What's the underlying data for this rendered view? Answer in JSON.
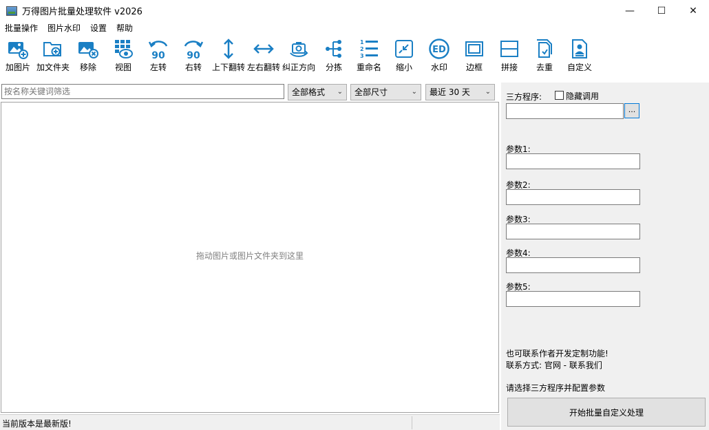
{
  "window": {
    "title": "万得图片批量处理软件 v2026",
    "minimize": "—",
    "maximize": "☐",
    "close": "✕"
  },
  "menu": [
    "批量操作",
    "图片水印",
    "设置",
    "帮助"
  ],
  "toolbar": [
    {
      "label": "加图片",
      "icon": "add-image-icon"
    },
    {
      "label": "加文件夹",
      "icon": "add-folder-icon"
    },
    {
      "label": "移除",
      "icon": "remove-image-icon"
    },
    {
      "label": "视图",
      "icon": "view-grid-icon"
    },
    {
      "label": "左转",
      "icon": "rotate-left-icon"
    },
    {
      "label": "右转",
      "icon": "rotate-right-icon"
    },
    {
      "label": "上下翻转",
      "icon": "flip-vertical-icon"
    },
    {
      "label": "左右翻转",
      "icon": "flip-horizontal-icon"
    },
    {
      "label": "纠正方向",
      "icon": "correct-orientation-icon"
    },
    {
      "label": "分拣",
      "icon": "sort-tree-icon"
    },
    {
      "label": "重命名",
      "icon": "rename-list-icon"
    },
    {
      "label": "缩小",
      "icon": "shrink-icon"
    },
    {
      "label": "水印",
      "icon": "watermark-icon"
    },
    {
      "label": "边框",
      "icon": "border-icon"
    },
    {
      "label": "拼接",
      "icon": "stitch-icon"
    },
    {
      "label": "去重",
      "icon": "dedupe-icon"
    },
    {
      "label": "自定义",
      "icon": "custom-icon"
    }
  ],
  "filter": {
    "search_placeholder": "按名称关键词筛选",
    "format_select": "全部格式",
    "size_select": "全部尺寸",
    "date_select": "最近 30 天"
  },
  "droparea": {
    "hint": "拖动图片或图片文件夹到这里"
  },
  "panel": {
    "third_party_label": "三方程序:",
    "hide_call_label": "隐藏调用",
    "browse_button": "...",
    "params": [
      "参数1:",
      "参数2:",
      "参数3:",
      "参数4:",
      "参数5:"
    ],
    "contact_line1": "也可联系作者开发定制功能!",
    "contact_line2": "联系方式: 官网 - 联系我们",
    "status": "请选择三方程序并配置参数",
    "start_button": "开始批量自定义处理"
  },
  "statusbar": {
    "text": "当前版本是最新版!"
  },
  "colors": {
    "icon_blue": "#1a7fc4",
    "panel_bg": "#f0f0f0",
    "button_border_focus": "#0078d7"
  }
}
